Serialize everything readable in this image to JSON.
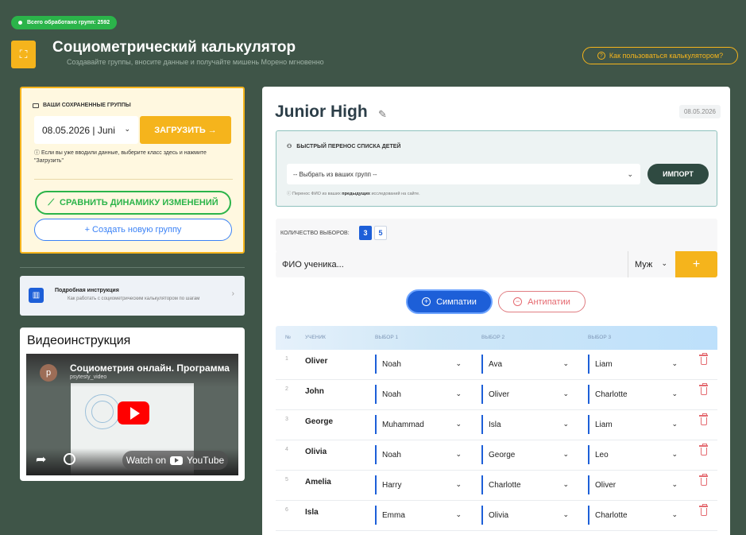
{
  "header": {
    "processed_badge": "Всего обработано групп: 2592",
    "title": "Социометрический калькулятор",
    "subtitle": "Создавайте группы, вносите данные и получайте мишень Морено мгновенно",
    "help_link": "Как пользоваться калькулятором?",
    "logo_icon": "hierarchy-icon"
  },
  "saved_groups": {
    "heading": "ВАШИ СОХРАНЕННЫЕ ГРУППЫ",
    "selected_value": "08.05.2026 | Juni",
    "load_button": "ЗАГРУЗИТЬ →",
    "hint": "Если вы уже вводили данные, выберите класс здесь и нажмите \"Загрузить\"",
    "compare_button": "СРАВНИТЬ ДИНАМИКУ ИЗМЕНЕНИЙ",
    "new_group_button": "+ Создать новую группу"
  },
  "instruction": {
    "title": "Подробная инструкция",
    "subtitle": "Как работать с социометрическим калькулятором по шагам"
  },
  "video": {
    "heading": "Видеоинструкция",
    "name": "Социометрия онлайн. Программа",
    "channel": "psytesty_video",
    "channel_initial": "p",
    "watch_label": "Watch on",
    "platform": "YouTube"
  },
  "main": {
    "class_title": "Junior High",
    "date": "08.05.2026",
    "import": {
      "heading": "БЫСТРЫЙ ПЕРЕНОС СПИСКА ДЕТЕЙ",
      "select_placeholder": "-- Выбрать из ваших групп --",
      "button": "ИМПОРТ",
      "hint_prefix": "Перенос ФИО из ваших ",
      "hint_bold": "предыдущих",
      "hint_suffix": " исследований на сайте."
    },
    "choices": {
      "label": "КОЛИЧЕСТВО ВЫБОРОВ:",
      "selected": "3",
      "other": "5"
    },
    "add": {
      "placeholder": "ФИО ученика...",
      "gender": "Муж",
      "add_symbol": "+"
    },
    "tabs": {
      "sympathies": "Симпатии",
      "antipathies": "Антипатии"
    },
    "table": {
      "headers": [
        "№",
        "УЧЕНИК",
        "ВЫБОР 1",
        "ВЫБОР 2",
        "ВЫБОР 3"
      ],
      "rows": [
        {
          "num": "1",
          "name": "Oliver",
          "c1": "Noah",
          "c2": "Ava",
          "c3": "Liam"
        },
        {
          "num": "2",
          "name": "John",
          "c1": "Noah",
          "c2": "Oliver",
          "c3": "Charlotte"
        },
        {
          "num": "3",
          "name": "George",
          "c1": "Muhammad",
          "c2": "Isla",
          "c3": "Liam"
        },
        {
          "num": "4",
          "name": "Olivia",
          "c1": "Noah",
          "c2": "George",
          "c3": "Leo"
        },
        {
          "num": "5",
          "name": "Amelia",
          "c1": "Harry",
          "c2": "Charlotte",
          "c3": "Oliver"
        },
        {
          "num": "6",
          "name": "Isla",
          "c1": "Emma",
          "c2": "Olivia",
          "c3": "Charlotte"
        }
      ]
    }
  },
  "colors": {
    "background": "#3f5548",
    "accent": "#f5b41c",
    "primary": "#1d5fd8",
    "success": "#2bb44a",
    "danger": "#e46a70"
  }
}
